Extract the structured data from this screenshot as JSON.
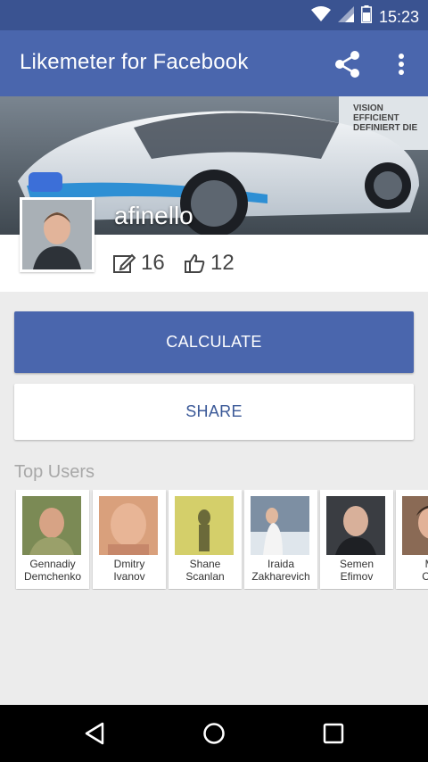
{
  "status_bar": {
    "time": "15:23",
    "icons": [
      "wifi-icon",
      "signal-icon",
      "battery-icon"
    ]
  },
  "app_bar": {
    "title": "Likemeter for Facebook",
    "actions": [
      "share-icon",
      "more-vert-icon"
    ]
  },
  "profile": {
    "username": "afinello",
    "posts_count": "16",
    "likes_count": "12",
    "cover_watermark": "VISION EFFICIENT DEFINIERT DIE"
  },
  "actions": {
    "calculate_label": "CALCULATE",
    "share_label": "SHARE"
  },
  "top_users": {
    "title": "Top Users",
    "users": [
      {
        "first": "Gennadiy",
        "last": "Demchenko"
      },
      {
        "first": "Dmitry",
        "last": "Ivanov"
      },
      {
        "first": "Shane",
        "last": "Scanlan"
      },
      {
        "first": "Iraida",
        "last": "Zakharevich"
      },
      {
        "first": "Semen",
        "last": "Efimov"
      },
      {
        "first": "Ми",
        "last": "Сем"
      }
    ]
  },
  "colors": {
    "status_bar": "#3a5391",
    "app_bar": "#4a66ad",
    "accent_text": "#3b5998",
    "background": "#ececec"
  },
  "nav_bar": {
    "icons": [
      "back-icon",
      "home-icon",
      "recents-icon"
    ]
  }
}
